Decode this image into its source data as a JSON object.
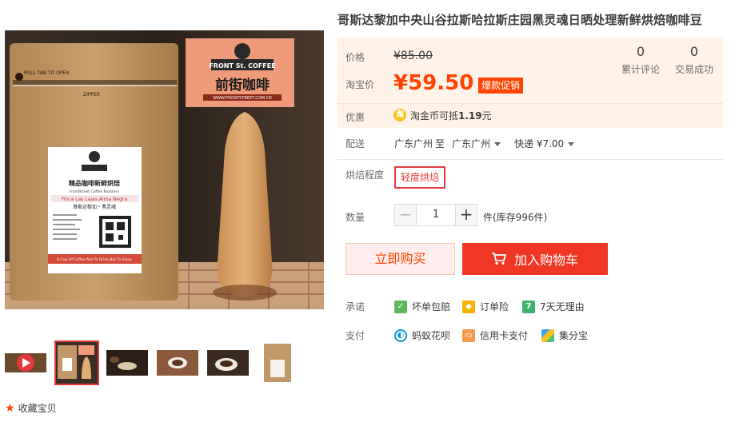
{
  "product": {
    "title": "哥斯达黎加中央山谷拉斯哈拉斯庄园黑灵魂日晒处理新鲜烘焙咖啡豆",
    "favorite_label": "收藏宝贝"
  },
  "price": {
    "original_label": "价格",
    "original_value": "¥85.00",
    "current_label": "淘宝价",
    "current_value": "¥59.50",
    "promo_badge": "爆款促销",
    "reviews_count": "0",
    "reviews_label": "累计评论",
    "sales_count": "0",
    "sales_label": "交易成功",
    "discount_label": "优惠",
    "discount_prefix": "淘金币可抵",
    "discount_amount": "1.19",
    "discount_suffix": "元"
  },
  "shipping": {
    "label": "配送",
    "from": "广东广州",
    "to_word": "至",
    "to": "广东广州",
    "method": "快递 ¥7.00"
  },
  "options": {
    "roast_label": "烘焙程度",
    "roast_value": "轻度烘焙"
  },
  "quantity": {
    "label": "数量",
    "value": "1",
    "minus": "−",
    "plus": "+",
    "stock": "件(库存996件)"
  },
  "actions": {
    "buy_now": "立即购买",
    "add_to_cart": "加入购物车"
  },
  "service": {
    "promise_label": "承诺",
    "promises": [
      "坏单包赔",
      "订单险",
      "7天无理由"
    ],
    "payment_label": "支付",
    "payments": [
      "蚂蚁花呗",
      "信用卡支付",
      "集分宝"
    ]
  },
  "image_text": {
    "sign_brand": "FRONT St. COFFEE",
    "sign_cn": "前街咖啡",
    "sign_url": "WWW.FRONTSTREET.COM.CN",
    "bag_pull": "PULL TAB TO OPEN",
    "bag_zipper": "ZIPPER",
    "label_cn": "精品咖啡新鲜烘焙",
    "label_en": "FrontStreet Coffee Roasters",
    "label_origin": "Finca Las Lajas Alma Negra",
    "label_origin_cn": "哥斯达黎加・黑灵魂",
    "label_slogan": "A Cup Of Coffee Not To Drink,But To Enjoy"
  }
}
